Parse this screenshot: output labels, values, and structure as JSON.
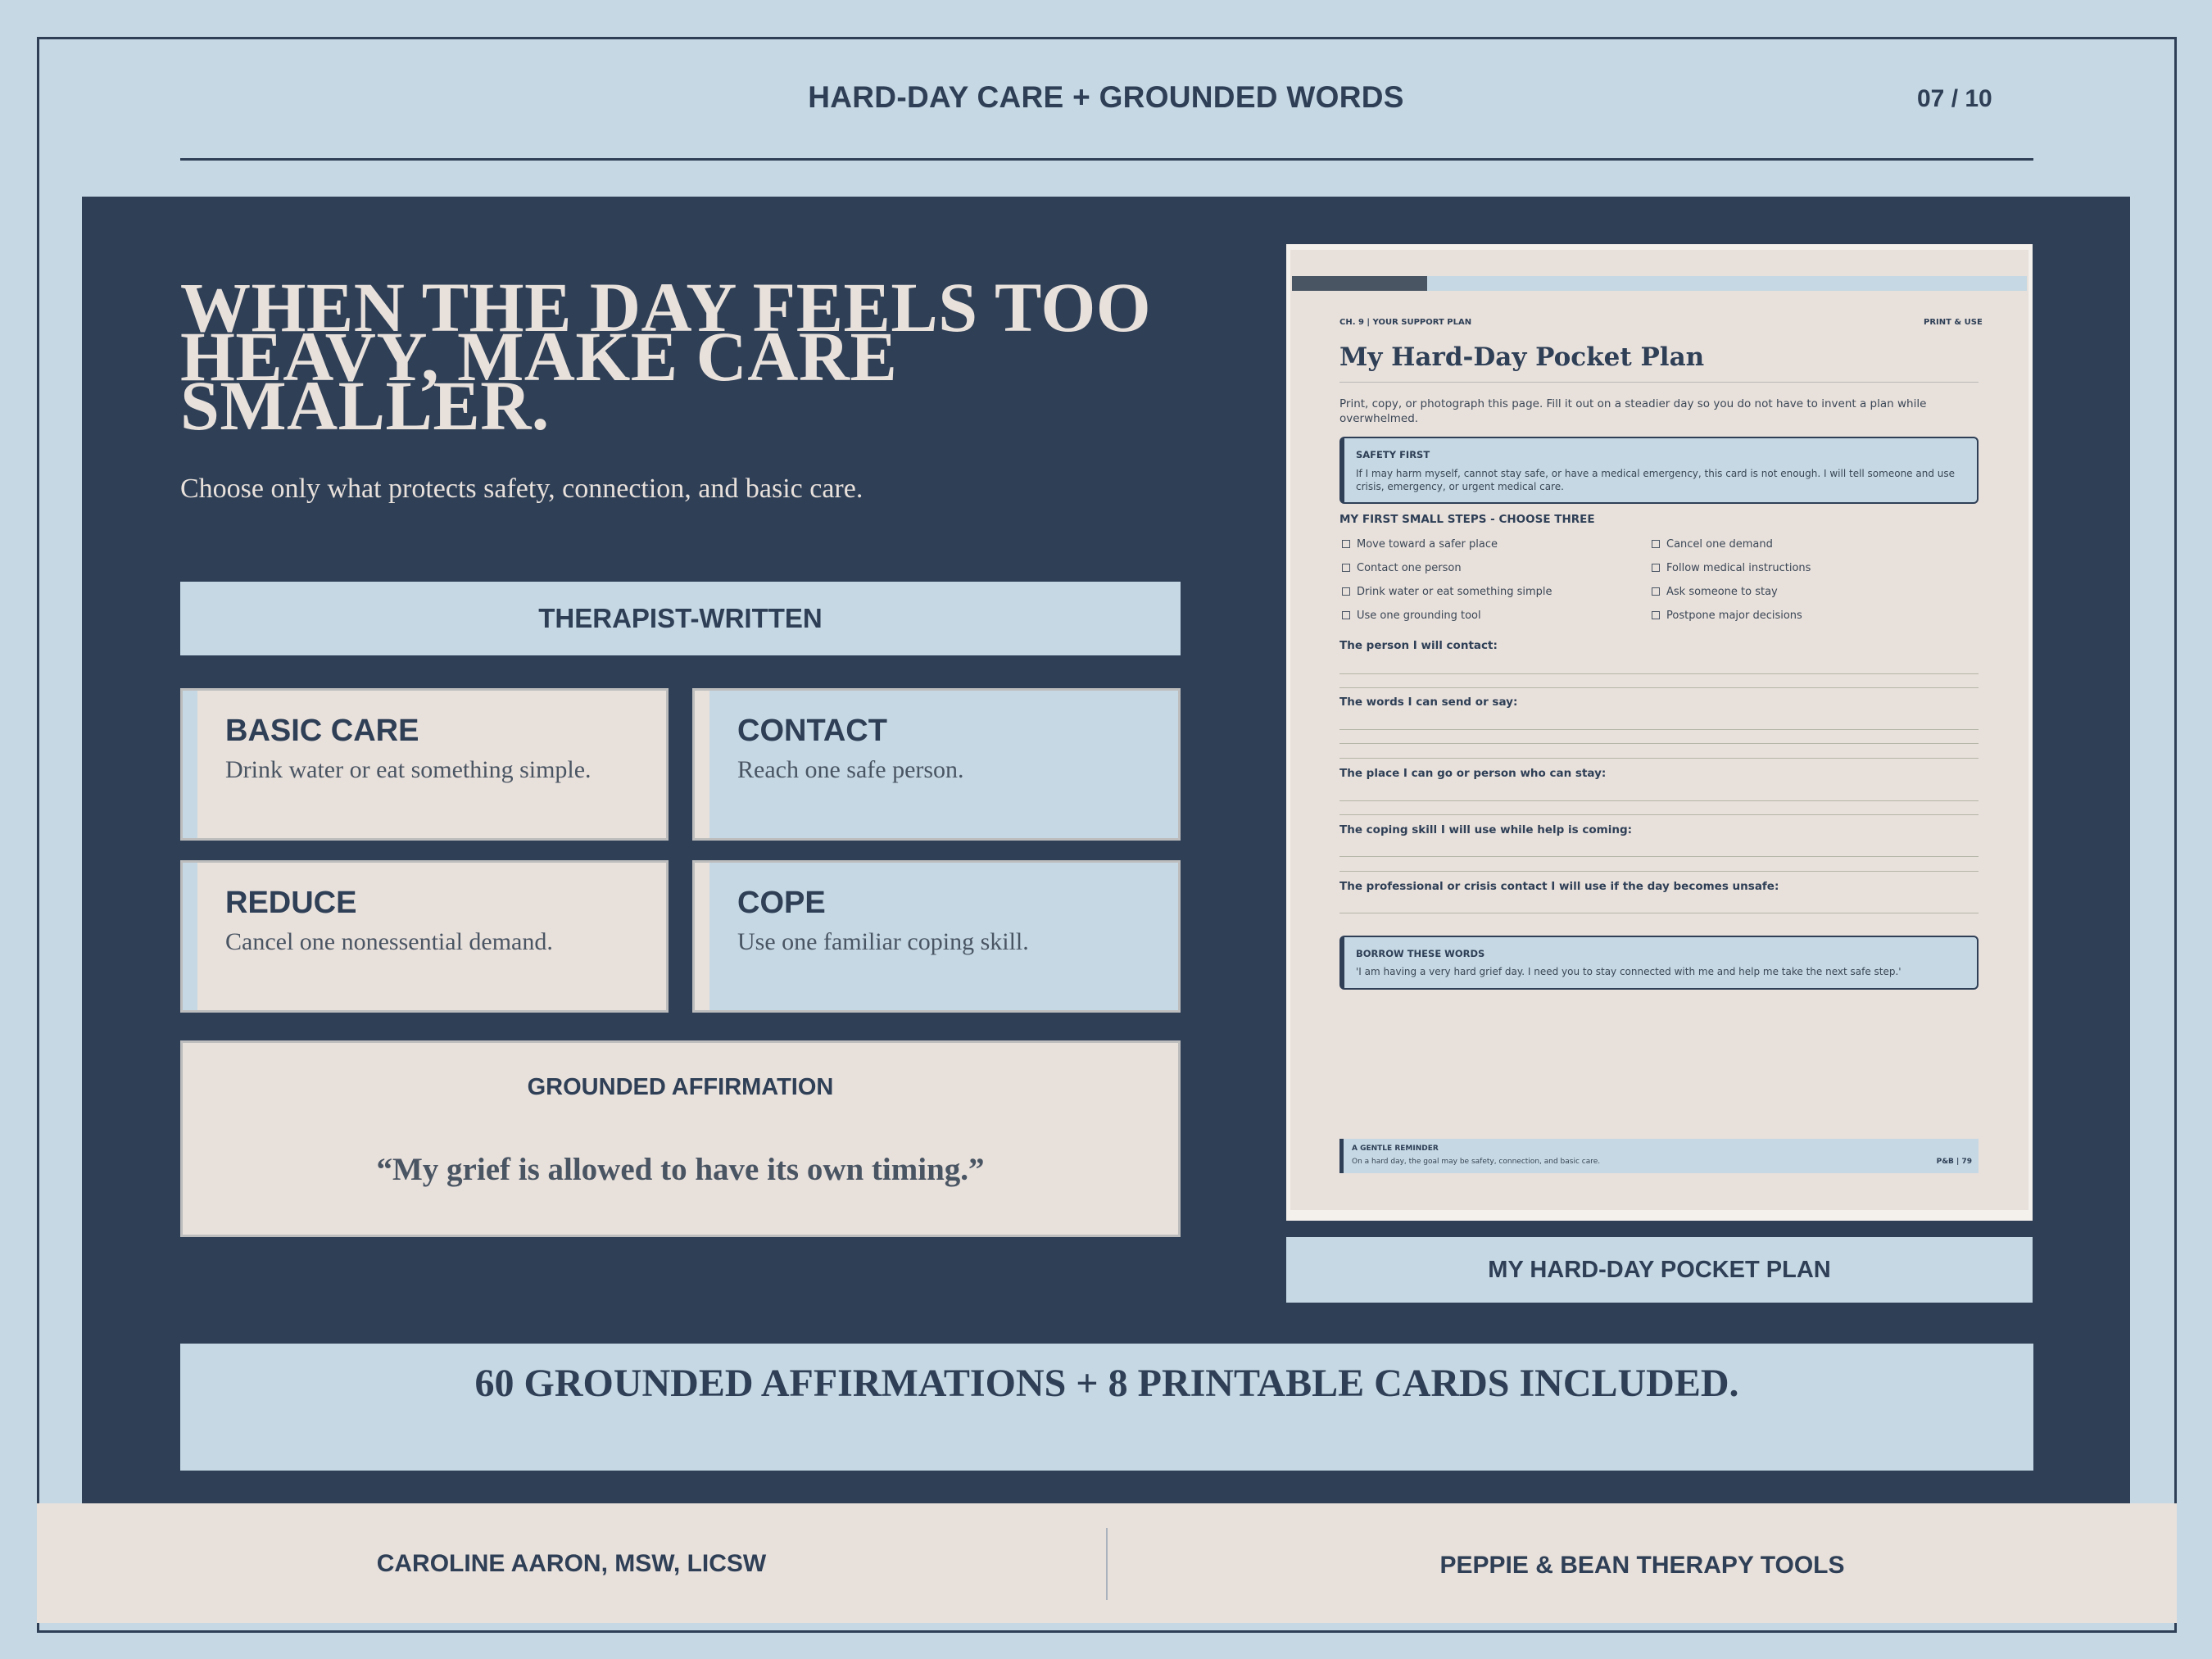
{
  "header": {
    "title": "HARD-DAY CARE + GROUNDED WORDS",
    "page": "07 / 10"
  },
  "hero": {
    "headline": "WHEN THE DAY FEELS TOO HEAVY, MAKE CARE SMALLER.",
    "subline": "Choose only what protects safety, connection, and basic care."
  },
  "therapist_band": "THERAPIST-WRITTEN",
  "cards": [
    {
      "title": "BASIC CARE",
      "text": "Drink water or eat something simple."
    },
    {
      "title": "CONTACT",
      "text": "Reach one safe person."
    },
    {
      "title": "REDUCE",
      "text": "Cancel one nonessential demand."
    },
    {
      "title": "COPE",
      "text": "Use one familiar coping skill."
    }
  ],
  "affirmation": {
    "label": "GROUNDED AFFIRMATION",
    "quote": "“My grief is allowed to have its own timing.”"
  },
  "doc": {
    "kicker": "CH. 9 | YOUR SUPPORT PLAN",
    "print": "PRINT & USE",
    "title": "My Hard-Day Pocket Plan",
    "intro": "Print, copy, or photograph this page. Fill it out on a steadier day so you do not have to invent a plan while overwhelmed.",
    "safety_title": "SAFETY FIRST",
    "safety_text": "If I may harm myself, cannot stay safe, or have a medical emergency, this card is not enough. I will tell someone and use crisis, emergency, or urgent medical care.",
    "steps_title": "MY FIRST SMALL STEPS - CHOOSE THREE",
    "steps": [
      "Move toward a safer place",
      "Contact one person",
      "Drink water or eat something simple",
      "Use one grounding tool",
      "Cancel one demand",
      "Follow medical instructions",
      "Ask someone to stay",
      "Postpone major decisions"
    ],
    "prompts": [
      "The person I will contact:",
      "The words I can send or say:",
      "The place I can go or person who can stay:",
      "The coping skill I will use while help is coming:",
      "The professional or crisis contact I will use if the day becomes unsafe:"
    ],
    "borrow_title": "BORROW THESE WORDS",
    "borrow_text": "'I am having a very hard grief day. I need you to stay connected with me and help me take the next safe step.'",
    "reminder_title": "A GENTLE REMINDER",
    "reminder_text": "On a hard day, the goal may be safety, connection, and basic care.",
    "reminder_page": "P&B | 79"
  },
  "doc_caption": "MY HARD-DAY POCKET PLAN",
  "promo": "60 GROUNDED AFFIRMATIONS + 8 PRINTABLE CARDS INCLUDED.",
  "footer": {
    "left": "CAROLINE AARON, MSW, LICSW",
    "right": "PEPPIE & BEAN THERAPY TOOLS"
  },
  "colors": {
    "navy": "#2e3f56",
    "light_blue": "#c5d8e3",
    "blush": "#e8e0db"
  }
}
